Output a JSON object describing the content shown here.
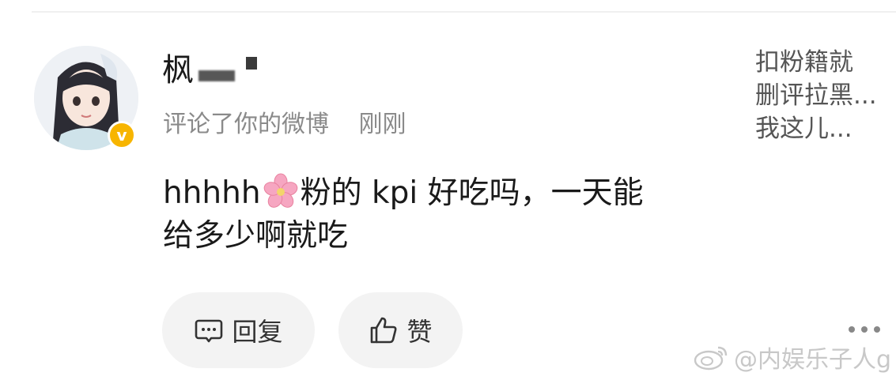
{
  "comment": {
    "username": "枫",
    "action_text": "评论了你的微博",
    "time": "刚刚",
    "text_line1_a": "hhhhh",
    "text_line1_b": "粉的 kpi 好吃吗，一天能",
    "text_line2": "给多少啊就吃",
    "verified_badge": "v"
  },
  "original_post_preview": {
    "line1": "扣粉籍就",
    "line2": "删评拉黑...",
    "line3": "我这儿..."
  },
  "actions": {
    "reply_label": "回复",
    "like_label": "赞"
  },
  "watermark": {
    "text": "@内娱乐子人g"
  },
  "icons": {
    "avatar": "anime-girl-avatar",
    "verified": "verified-badge-icon",
    "emoji": "cherry-blossom-icon",
    "reply": "comment-bubble-icon",
    "like": "thumbs-up-icon",
    "more": "more-dots-icon",
    "watermark": "weibo-logo-icon"
  },
  "colors": {
    "badge": "#f7b500",
    "button_bg": "#f3f3f3",
    "meta_text": "#8a8a8a",
    "blossom": "#f6a6c1"
  }
}
